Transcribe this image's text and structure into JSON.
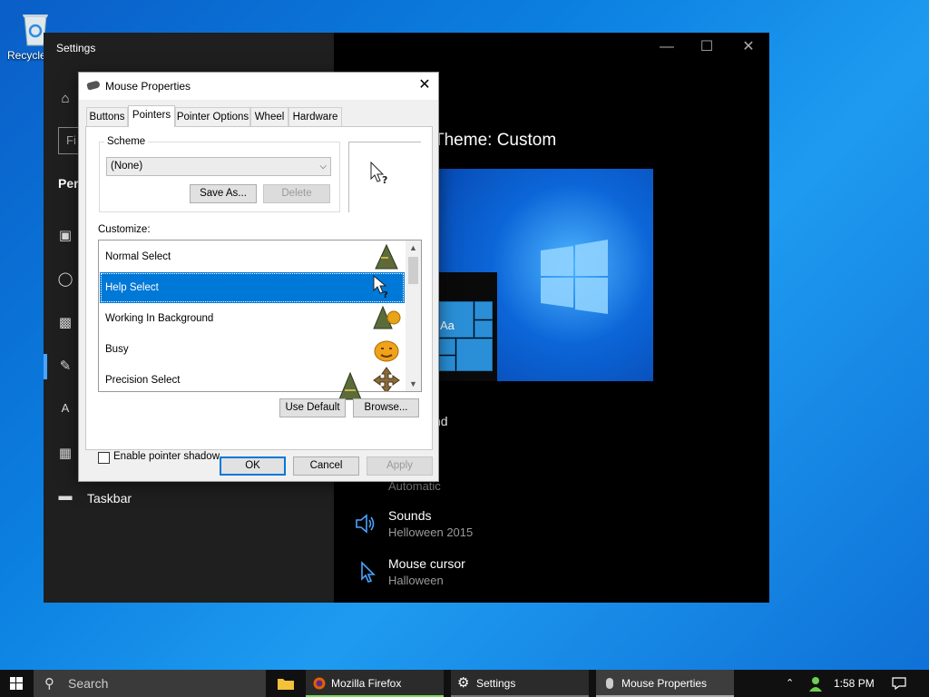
{
  "desktop": {
    "recycle_bin_label": "Recycle Bin"
  },
  "settings": {
    "title": "Settings",
    "search_placeholder": "Fi",
    "section_heading": "Per",
    "nav_taskbar": "Taskbar",
    "theme_title": "Theme: Custom",
    "preview_sample": "Aa",
    "background_label": "nd",
    "color_value": "Automatic",
    "items": [
      {
        "title": "Sounds",
        "value": "Helloween 2015"
      },
      {
        "title": "Mouse cursor",
        "value": "Halloween"
      }
    ]
  },
  "dialog": {
    "title": "Mouse Properties",
    "tabs": [
      "Buttons",
      "Pointers",
      "Pointer Options",
      "Wheel",
      "Hardware"
    ],
    "active_tab": "Pointers",
    "scheme_label": "Scheme",
    "scheme_value": "(None)",
    "save_as_label": "Save As...",
    "delete_label": "Delete",
    "customize_label": "Customize:",
    "pointers": [
      {
        "name": "Normal Select",
        "icon": "witch-hat-arrow-icon"
      },
      {
        "name": "Help Select",
        "icon": "help-select-icon",
        "selected": true
      },
      {
        "name": "Working In Background",
        "icon": "witch-hat-pumpkin-icon"
      },
      {
        "name": "Busy",
        "icon": "pumpkin-icon"
      },
      {
        "name": "Precision Select",
        "icon": "move-cross-icon"
      }
    ],
    "shadow_label": "Enable pointer shadow",
    "shadow_checked": false,
    "use_default_label": "Use Default",
    "browse_label": "Browse...",
    "ok_label": "OK",
    "cancel_label": "Cancel",
    "apply_label": "Apply"
  },
  "taskbar": {
    "search_text": "Search",
    "apps": [
      {
        "label": "Mozilla Firefox",
        "icon": "firefox-icon"
      },
      {
        "label": "Settings",
        "icon": "gear-icon"
      },
      {
        "label": "Mouse Properties",
        "icon": "mouse-icon"
      }
    ],
    "time": "1:58 PM"
  }
}
